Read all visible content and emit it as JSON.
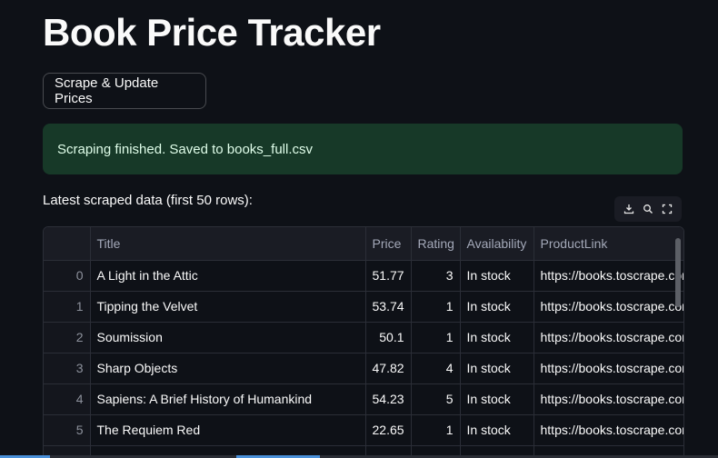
{
  "app": {
    "title": "Book Price Tracker",
    "button_label": "Scrape & Update Prices",
    "success_message": "Scraping finished. Saved to books_full.csv",
    "caption": "Latest scraped data (first 50 rows):"
  },
  "toolbar": {
    "icons": [
      "download-icon",
      "search-icon",
      "fullscreen-icon"
    ]
  },
  "table": {
    "columns": [
      "",
      "Title",
      "Price",
      "Rating",
      "Availability",
      "ProductLink"
    ],
    "rows": [
      {
        "index": "0",
        "title": "A Light in the Attic",
        "price": "51.77",
        "rating": "3",
        "availability": "In stock",
        "link": "https://books.toscrape.com"
      },
      {
        "index": "1",
        "title": "Tipping the Velvet",
        "price": "53.74",
        "rating": "1",
        "availability": "In stock",
        "link": "https://books.toscrape.com"
      },
      {
        "index": "2",
        "title": "Soumission",
        "price": "50.1",
        "rating": "1",
        "availability": "In stock",
        "link": "https://books.toscrape.com"
      },
      {
        "index": "3",
        "title": "Sharp Objects",
        "price": "47.82",
        "rating": "4",
        "availability": "In stock",
        "link": "https://books.toscrape.com"
      },
      {
        "index": "4",
        "title": "Sapiens: A Brief History of Humankind",
        "price": "54.23",
        "rating": "5",
        "availability": "In stock",
        "link": "https://books.toscrape.com"
      },
      {
        "index": "5",
        "title": "The Requiem Red",
        "price": "22.65",
        "rating": "1",
        "availability": "In stock",
        "link": "https://books.toscrape.com"
      },
      {
        "index": "6",
        "title": "",
        "price": "",
        "rating": "",
        "availability": "",
        "link": ""
      }
    ]
  },
  "colors": {
    "background": "#0e1117",
    "success_bg": "#173928",
    "success_text": "#dffde9"
  }
}
